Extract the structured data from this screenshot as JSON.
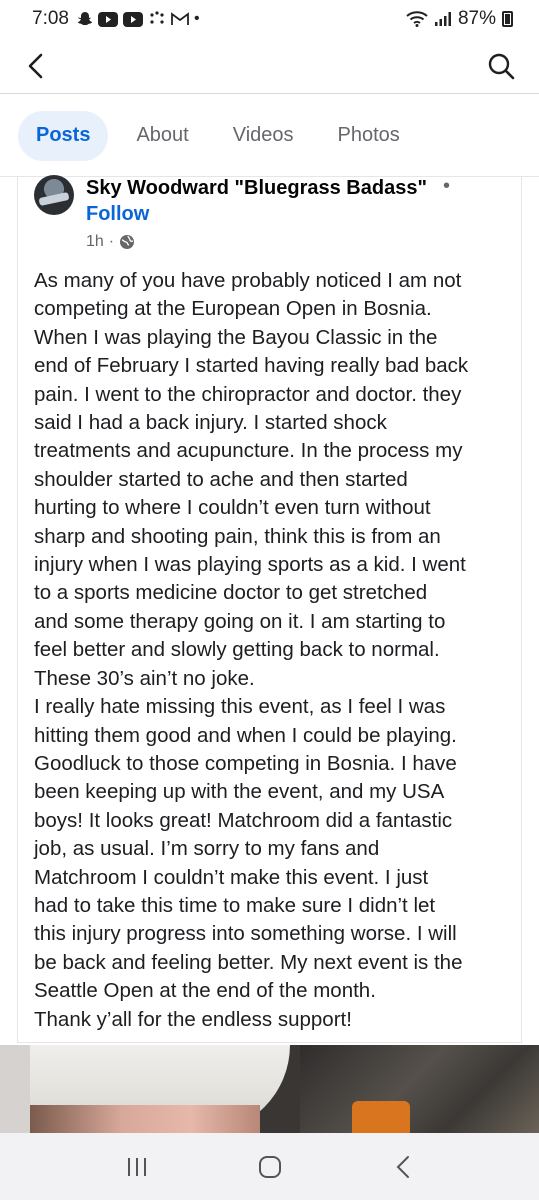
{
  "status_bar": {
    "time": "7:08",
    "notification_icons": [
      "snapchat-icon",
      "youtube-icon",
      "youtube-icon",
      "dots-icon",
      "gmail-icon"
    ],
    "more_dot": "•",
    "battery": "87%"
  },
  "nav": {
    "back_icon": "back-arrow-icon",
    "search_icon": "search-icon"
  },
  "tabs": [
    {
      "label": "Posts",
      "active": true
    },
    {
      "label": "About",
      "active": false
    },
    {
      "label": "Videos",
      "active": false
    },
    {
      "label": "Photos",
      "active": false
    }
  ],
  "post": {
    "author": "Sky Woodward \"Bluegrass Badass\"",
    "separator": "•",
    "follow": "Follow",
    "time": "1h",
    "time_separator": "·",
    "privacy_icon": "globe-icon",
    "lines": [
      "As many of you have probably noticed I am not",
      "competing at the European Open in Bosnia.",
      "When I was playing the Bayou Classic in the",
      "end of February I started having really bad back",
      "pain. I went to the chiropractor and doctor. they",
      "said I had a back injury. I started shock",
      "treatments and acupuncture. In the process my",
      "shoulder started to ache and then started",
      "hurting to where I couldn’t even turn without",
      "sharp and shooting pain, think this is from an",
      "injury when I was playing sports as a kid. I went",
      "to a sports medicine doctor to get stretched",
      "and some therapy going on it. I am starting to",
      "feel better and slowly getting back to normal.",
      "These 30’s ain’t no joke.",
      "I really hate missing this event, as I feel I was",
      "hitting them good and when I could be playing.",
      "Goodluck to those competing in Bosnia. I have",
      "been keeping up with the event, and my USA",
      "boys! It looks great! Matchroom did a fantastic",
      "job, as usual. I’m sorry to my fans and",
      "Matchroom I couldn’t make this event. I just",
      "had to take this time to make sure I didn’t let",
      "this injury progress into something worse. I will",
      "be back and feeling better. My next event is the",
      "Seattle Open at the end of the month.",
      "Thank y’all for the endless support!"
    ]
  },
  "system_nav": {
    "recents": "recents-icon",
    "home": "home-icon",
    "back": "back-icon"
  },
  "colors": {
    "accent": "#0a66d8",
    "active_tab_bg": "#e7f0fb",
    "secondary_text": "#65676b",
    "system_nav_bg": "#f2f2f4"
  }
}
